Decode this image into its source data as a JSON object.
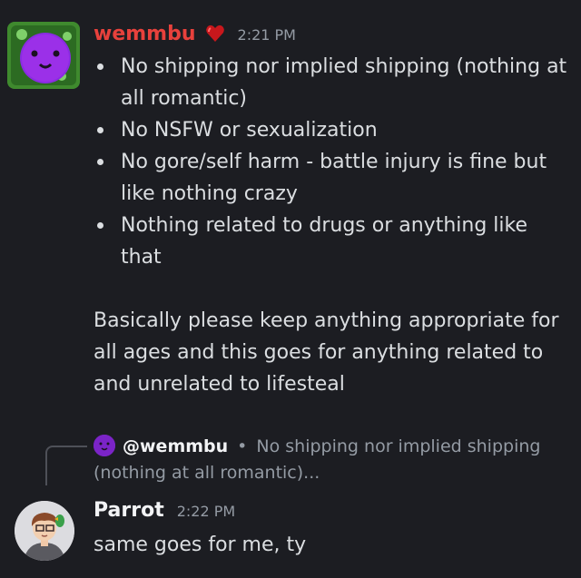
{
  "messages": [
    {
      "author": "wemmbu",
      "author_color": "#e8413c",
      "badge": "heart-icon",
      "time": "2:21 PM",
      "rules": [
        "No shipping nor implied shipping (nothing at all romantic)",
        "No NSFW or sexualization",
        "No gore/self harm - battle injury is fine but like nothing crazy",
        "Nothing related to drugs or anything like that"
      ],
      "paragraph": "Basically please keep anything appropriate for all ages and this goes for anything related to and unrelated to lifesteal"
    },
    {
      "reply": {
        "mention": "@wemmbu",
        "separator": "•",
        "preview_line1": "No shipping nor implied shipping",
        "preview_line2": "(nothing at all romantic)..."
      },
      "author": "Parrot",
      "author_color": "#f2f3f5",
      "time": "2:22 PM",
      "text": "same goes for me, ty"
    }
  ],
  "colors": {
    "background": "#1c1d22",
    "text": "#dbdee1",
    "muted": "#949ba4",
    "avatar_purple": "#7b24c7",
    "slime_green": "#3a8a2a"
  }
}
